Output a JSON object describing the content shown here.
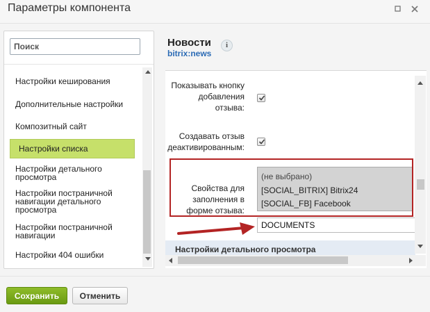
{
  "window": {
    "title": "Параметры компонента"
  },
  "icons": {
    "expand": "expand-icon",
    "close": "close-icon",
    "info": "info-icon"
  },
  "search": {
    "placeholder": "Поиск"
  },
  "sidebar": {
    "items": [
      {
        "label": "Настройки кеширования"
      },
      {
        "label": "Дополнительные настройки"
      },
      {
        "label": "Композитный сайт"
      },
      {
        "label": "Настройки списка",
        "active": true
      },
      {
        "label": "Настройки детального\nпросмотра"
      },
      {
        "label": "Настройки постраничной\nнавигации детального\nпросмотра"
      },
      {
        "label": "Настройки постраничной\nнавигации"
      },
      {
        "label": "Настройки 404 ошибки"
      }
    ]
  },
  "component": {
    "name": "Новости",
    "code": "bitrix:news",
    "info_glyph": "i"
  },
  "params": {
    "show_add_review": {
      "label": "Показывать кнопку\nдобавления\nотзыва:",
      "checked": true
    },
    "create_deactivated": {
      "label": "Создавать отзыв\nдеактивированным:",
      "checked": true
    },
    "review_props": {
      "label": "Свойства для\nзаполнения в\nформе отзыва:",
      "options": [
        "(не выбрано)",
        "[SOCIAL_BITRIX] Bitrix24",
        "[SOCIAL_FB] Facebook"
      ]
    },
    "documents_value": "DOCUMENTS"
  },
  "section": {
    "header": "Настройки детального просмотра"
  },
  "footer": {
    "save_label": "Сохранить",
    "cancel_label": "Отменить"
  },
  "colors": {
    "save_button": "#76a81a",
    "active_item": "#c6e06a",
    "highlight_border": "#b32424",
    "code_link": "#2b6bb5"
  }
}
